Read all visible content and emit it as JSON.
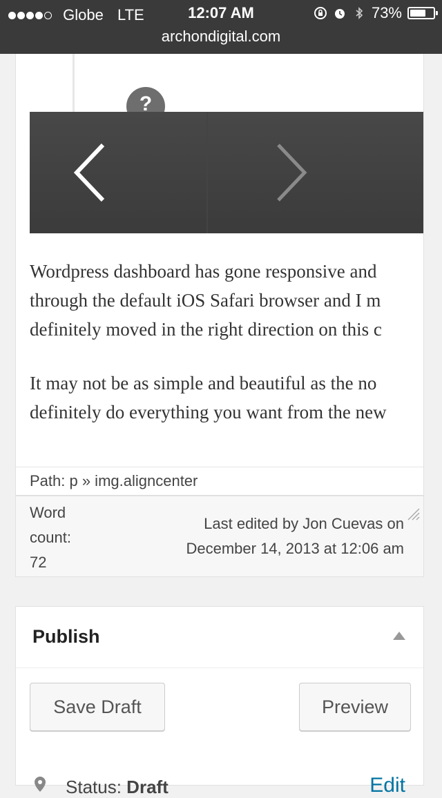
{
  "status_bar": {
    "carrier": "Globe",
    "network": "LTE",
    "time": "12:07 AM",
    "battery_percent": "73%",
    "battery_level": 0.73,
    "url": "archondigital.com",
    "icons": [
      "rotation-lock-icon",
      "alarm-icon",
      "bluetooth-icon",
      "battery-icon"
    ]
  },
  "gallery": {
    "help_label": "?",
    "prev_icon": "chevron-left-icon",
    "next_icon": "chevron-right-icon"
  },
  "post_body": {
    "paragraph_1_lines": [
      "Wordpress dashboard has gone responsive and",
      "through the default iOS Safari browser and I m",
      "definitely moved in the right direction on this c"
    ],
    "paragraph_2_lines": [
      "It may not be as simple and beautiful as the no",
      "definitely do everything you want from the new"
    ]
  },
  "editor_footer": {
    "path": "Path: p » img.aligncenter",
    "word_count_lines": [
      "Word",
      "count:",
      "72"
    ],
    "last_edited_lines": [
      "Last edited by Jon Cuevas on",
      "December 14, 2013 at 12:06 am"
    ]
  },
  "publish": {
    "title": "Publish",
    "save_draft_label": "Save Draft",
    "preview_label": "Preview",
    "status_label": "Status:",
    "status_value": "Draft",
    "edit_label": "Edit"
  },
  "colors": {
    "status_bar_bg": "#3a3a3a",
    "page_bg": "#f1f1f1",
    "link": "#0074a2"
  }
}
